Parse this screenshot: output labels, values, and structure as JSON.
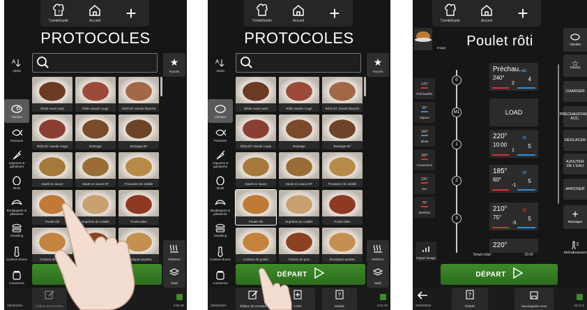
{
  "header": {
    "combiguide_label": "CombiGuide",
    "accueil_label": "Accueil"
  },
  "screen1": {
    "title": "PROTOCOLES",
    "categories": [
      {
        "label": "Alpha"
      },
      {
        "label": "Viandes"
      },
      {
        "label": "Poissons"
      },
      {
        "label": "Légumes & garnitures"
      },
      {
        "label": "Œufs"
      },
      {
        "label": "Boulangerie & pâtisserie"
      },
      {
        "label": "Snacking"
      },
      {
        "label": "Cuisson douce"
      },
      {
        "label": "Conserves"
      }
    ],
    "favoris_label": "Favoris",
    "retherm_label": "Retherm",
    "multi_label": "Multi",
    "depart_label": "DÉPART",
    "recipes": [
      {
        "label": "White meat roast",
        "color": "#6b3a22"
      },
      {
        "label": "Rôtis viande rouge",
        "color": "#9c4a3a"
      },
      {
        "label": "Rôtis BT viande blanche",
        "color": "#a36848"
      },
      {
        "label": "Rôtis BT viande rouge",
        "color": "#8b3e34"
      },
      {
        "label": "Braisage",
        "color": "#7a4a2a"
      },
      {
        "label": "Braisage BT",
        "color": "#6e4428"
      },
      {
        "label": "Sauté en sauce",
        "color": "#a6783a"
      },
      {
        "label": "Sauté en sauce BT",
        "color": "#9a6d36"
      },
      {
        "label": "Fricassée de volaille",
        "color": "#b88a48"
      },
      {
        "label": "Poulet rôti",
        "color": "#c07a36"
      },
      {
        "label": "Suprême de volaille",
        "color": "#c9a070"
      },
      {
        "label": "Poulet ailes",
        "color": "#8e3a22"
      },
      {
        "label": "Cuisses de poulet",
        "color": "#c48440"
      },
      {
        "label": "Travers de porc",
        "color": "#8a4220"
      },
      {
        "label": "Escalopes panées",
        "color": "#c49050"
      }
    ],
    "bottom_button_label": "Éditeur de Recettes",
    "date": "28/05/2024",
    "time": "9:06:25"
  },
  "screen2": {
    "title": "PROTOCOLES",
    "depart_label": "DÉPART",
    "bottom_buttons": [
      "Éditeur de recettes",
      "Créer",
      "Détails"
    ],
    "date": "28/05/2024",
    "time": "9:11:20"
  },
  "screen3": {
    "title": "Poulet rôti",
    "image_label": "Image",
    "left_modes": [
      {
        "value": "175°",
        "label": "Préchauffer"
      },
      {
        "value": "98°",
        "label": "Vapeur"
      },
      {
        "value": "160°",
        "label": "Mixte"
      },
      {
        "value": "180°",
        "label": "Convection"
      },
      {
        "value": "235°",
        "label": "Sec"
      },
      {
        "value": "70°",
        "label": "Maintien"
      }
    ],
    "impact_label": "Impact lavage",
    "timeline_nodes": [
      "0",
      "M1",
      "1",
      "2",
      "3"
    ],
    "steps": [
      {
        "a": "Préchau...",
        "b": "240°",
        "c": "2",
        "pct": "4"
      },
      {
        "a": "LOAD"
      },
      {
        "a": "220°",
        "b": "10:00",
        "c": "1",
        "pct": "5"
      },
      {
        "a": "185°",
        "b": "60°",
        "c": "-1",
        "pct": "5"
      },
      {
        "a": "210°",
        "b": "75°",
        "c": "-3",
        "pct": "5"
      },
      {
        "a": "220°"
      }
    ],
    "right_buttons": [
      "CHARGER",
      "PRECHAUFFAGE ACC.",
      "DEGLACER",
      "AJOUTER DE L'EAU",
      "ARROSER"
    ],
    "right_top": {
      "viandes": "Viandes",
      "favoris": "Favoris"
    },
    "messages_label": "Messages",
    "refroidir_label": "Refroidissement",
    "temps_total_label": "Temps total :",
    "temps_total_value": "10:00",
    "depart_label": "DÉPART",
    "bottom_buttons": [
      "Détails",
      "Sauvegarder sous"
    ],
    "date": "28/05/2024",
    "time": "10:21:0"
  },
  "colors": {
    "green": "#3e8a2a",
    "red": "#d8322c",
    "blue": "#2f8fd8"
  }
}
